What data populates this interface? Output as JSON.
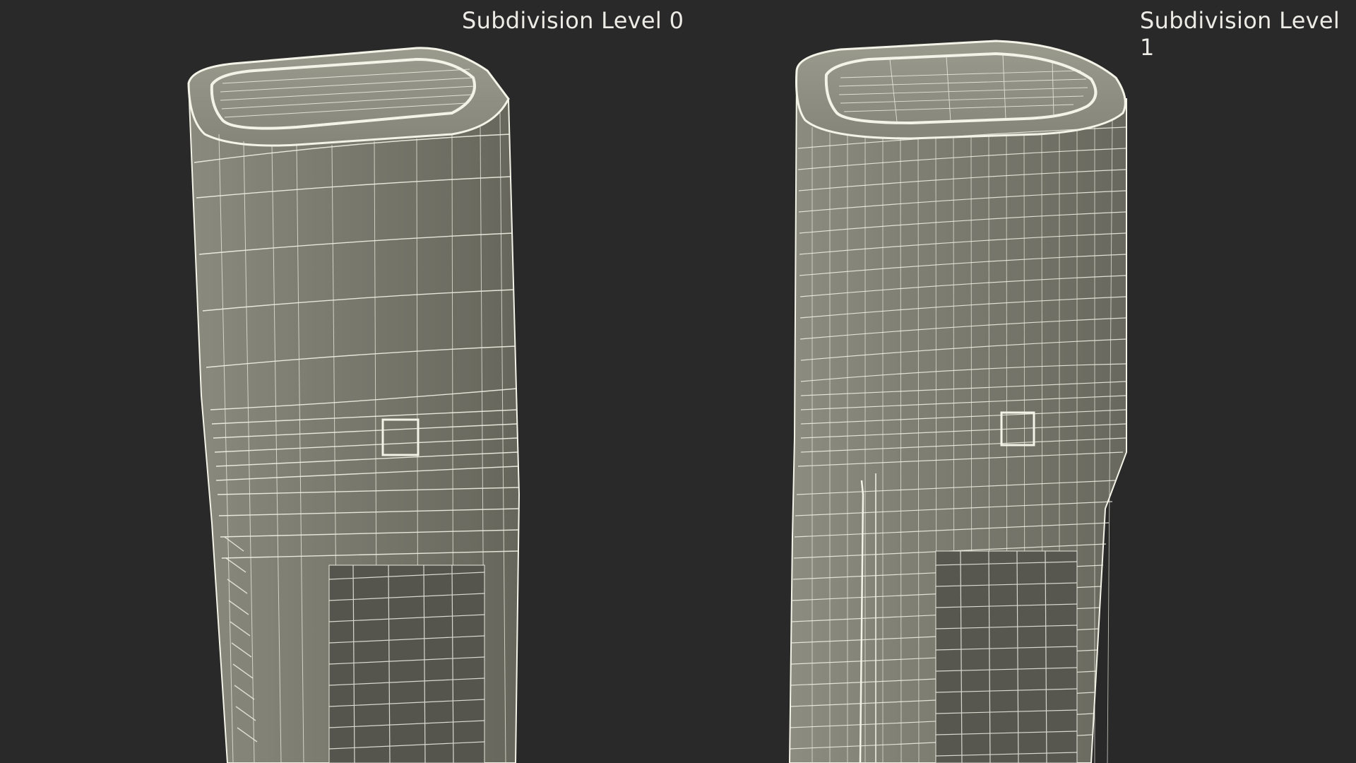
{
  "panels": [
    {
      "title": "Subdivision Level 0",
      "subdivision_level": 0
    },
    {
      "title": "Subdivision Level 1",
      "subdivision_level": 1
    }
  ],
  "colors": {
    "background": "#292929",
    "surface": "#7b7b70",
    "wire": "#f4f3e8",
    "title_text": "#ecebe6"
  }
}
